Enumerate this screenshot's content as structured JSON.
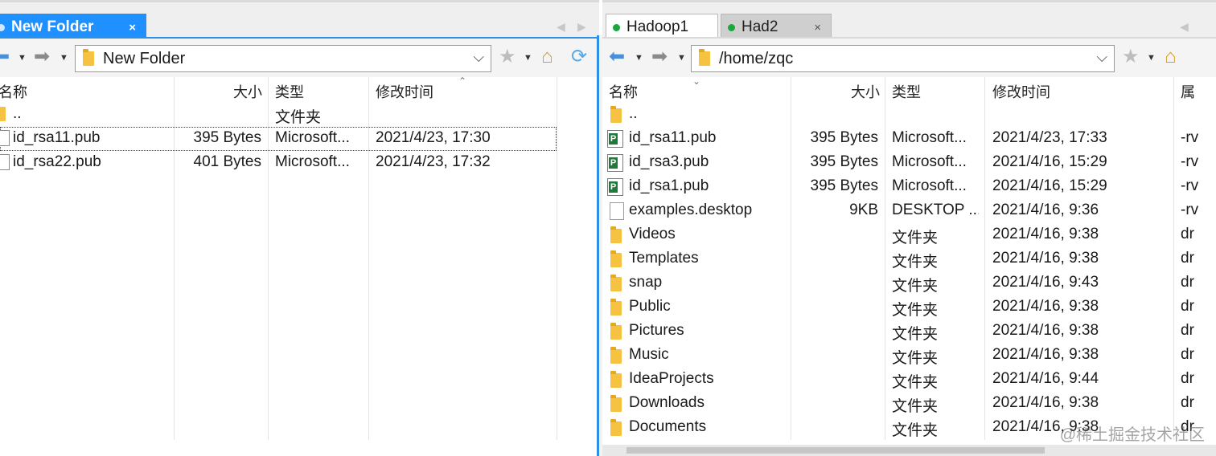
{
  "left": {
    "tabs": [
      {
        "label": "New Folder",
        "close": "×"
      }
    ],
    "path": "New Folder",
    "columns": {
      "name": "名称",
      "size": "大小",
      "type": "类型",
      "modified": "修改时间"
    },
    "rows": [
      {
        "name": "..",
        "size": "",
        "type": "文件夹",
        "modified": "",
        "icon": "folder-icon"
      },
      {
        "name": "id_rsa11.pub",
        "size": "395 Bytes",
        "type": "Microsoft...",
        "modified": "2021/4/23, 17:30",
        "icon": "pub-file-icon"
      },
      {
        "name": "id_rsa22.pub",
        "size": "401 Bytes",
        "type": "Microsoft...",
        "modified": "2021/4/23, 17:32",
        "icon": "pub-file-icon"
      }
    ]
  },
  "right": {
    "tabs": [
      {
        "label": "Hadoop1"
      },
      {
        "label": "Had2",
        "close": "×"
      }
    ],
    "path": "/home/zqc",
    "columns": {
      "name": "名称",
      "size": "大小",
      "type": "类型",
      "modified": "修改时间",
      "attr": "属"
    },
    "rows": [
      {
        "name": "..",
        "size": "",
        "type": "",
        "modified": "",
        "attr": "",
        "icon": "folder-icon"
      },
      {
        "name": "id_rsa11.pub",
        "size": "395 Bytes",
        "type": "Microsoft...",
        "modified": "2021/4/23, 17:33",
        "attr": "-rv",
        "icon": "publisher-file-icon"
      },
      {
        "name": "id_rsa3.pub",
        "size": "395 Bytes",
        "type": "Microsoft...",
        "modified": "2021/4/16, 15:29",
        "attr": "-rv",
        "icon": "publisher-file-icon"
      },
      {
        "name": "id_rsa1.pub",
        "size": "395 Bytes",
        "type": "Microsoft...",
        "modified": "2021/4/16, 15:29",
        "attr": "-rv",
        "icon": "publisher-file-icon"
      },
      {
        "name": "examples.desktop",
        "size": "9KB",
        "type": "DESKTOP ...",
        "modified": "2021/4/16, 9:36",
        "attr": "-rv",
        "icon": "file-icon"
      },
      {
        "name": "Videos",
        "size": "",
        "type": "文件夹",
        "modified": "2021/4/16, 9:38",
        "attr": "dr",
        "icon": "folder-icon"
      },
      {
        "name": "Templates",
        "size": "",
        "type": "文件夹",
        "modified": "2021/4/16, 9:38",
        "attr": "dr",
        "icon": "folder-icon"
      },
      {
        "name": "snap",
        "size": "",
        "type": "文件夹",
        "modified": "2021/4/16, 9:43",
        "attr": "dr",
        "icon": "folder-icon"
      },
      {
        "name": "Public",
        "size": "",
        "type": "文件夹",
        "modified": "2021/4/16, 9:38",
        "attr": "dr",
        "icon": "folder-icon"
      },
      {
        "name": "Pictures",
        "size": "",
        "type": "文件夹",
        "modified": "2021/4/16, 9:38",
        "attr": "dr",
        "icon": "folder-icon"
      },
      {
        "name": "Music",
        "size": "",
        "type": "文件夹",
        "modified": "2021/4/16, 9:38",
        "attr": "dr",
        "icon": "folder-icon"
      },
      {
        "name": "IdeaProjects",
        "size": "",
        "type": "文件夹",
        "modified": "2021/4/16, 9:44",
        "attr": "dr",
        "icon": "folder-icon"
      },
      {
        "name": "Downloads",
        "size": "",
        "type": "文件夹",
        "modified": "2021/4/16, 9:38",
        "attr": "dr",
        "icon": "folder-icon"
      },
      {
        "name": "Documents",
        "size": "",
        "type": "文件夹",
        "modified": "2021/4/16, 9:38",
        "attr": "dr",
        "icon": "folder-icon"
      }
    ]
  },
  "watermark": "@稀土掘金技术社区",
  "colors": {
    "accent": "#1e90ff",
    "tab_grey": "#cfcfcf",
    "folder": "#f5c242",
    "connected_dot": "#1aa83c"
  }
}
